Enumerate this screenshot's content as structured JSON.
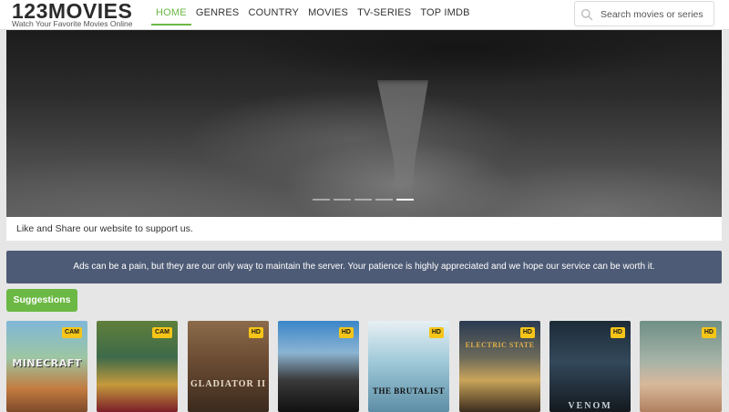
{
  "header": {
    "logo_main": "123MOVIES",
    "logo_sub": "Watch Your Favorite Movies Online",
    "nav": [
      {
        "label": "HOME",
        "active": true
      },
      {
        "label": "GENRES",
        "active": false
      },
      {
        "label": "COUNTRY",
        "active": false
      },
      {
        "label": "MOVIES",
        "active": false
      },
      {
        "label": "TV-SERIES",
        "active": false
      },
      {
        "label": "TOP IMDB",
        "active": false
      }
    ],
    "search_placeholder": "Search movies or series"
  },
  "hero": {
    "slide_count": 5,
    "active_slide": 5
  },
  "share_text": "Like and Share our website to support us.",
  "notice_text": "Ads can be a pain, but they are our only way to maintain the server. Your patience is highly appreciated and we hope our service can be worth it.",
  "suggestions_label": "Suggestions",
  "posters": [
    {
      "badge": "CAM",
      "title": "MINECRAFT"
    },
    {
      "badge": "CAM",
      "title": ""
    },
    {
      "badge": "HD",
      "title": "GLADIATOR II"
    },
    {
      "badge": "HD",
      "title": ""
    },
    {
      "badge": "HD",
      "title": "THE BRUTALIST"
    },
    {
      "badge": "HD",
      "title": "ELECTRIC STATE"
    },
    {
      "badge": "HD",
      "title": "VENOM"
    },
    {
      "badge": "HD",
      "title": ""
    }
  ],
  "colors": {
    "accent": "#6cb844",
    "notice_bg": "#4e5b76",
    "badge": "#f5c518"
  }
}
